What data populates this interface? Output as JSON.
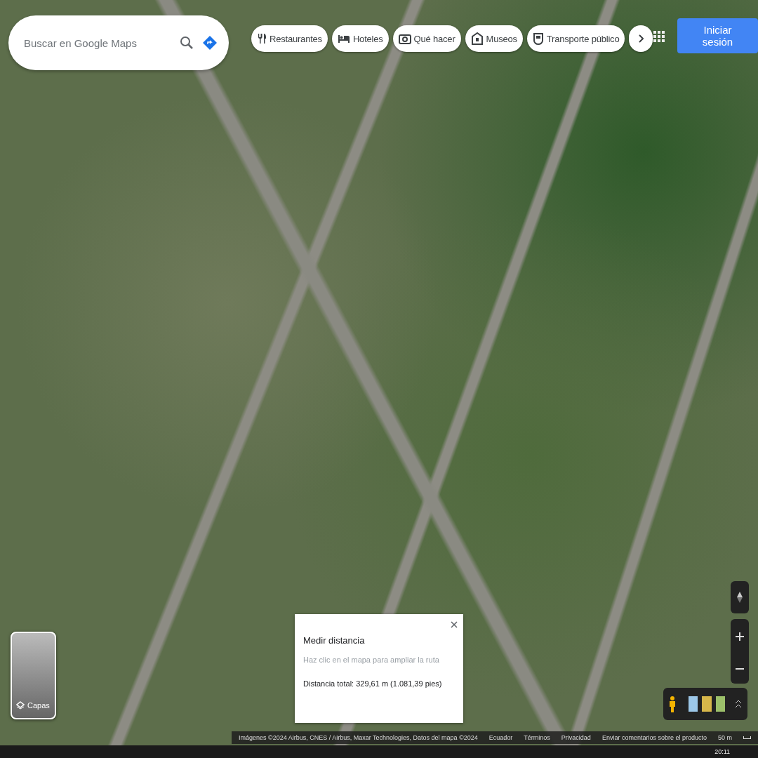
{
  "search": {
    "placeholder": "Buscar en Google Maps"
  },
  "chips": [
    {
      "label": "Restaurantes",
      "kind": "restaurant"
    },
    {
      "label": "Hoteles",
      "kind": "hotel"
    },
    {
      "label": "Qué hacer",
      "kind": "camera"
    },
    {
      "label": "Museos",
      "kind": "museum"
    },
    {
      "label": "Transporte público",
      "kind": "transit"
    }
  ],
  "sign_in": "Iniciar sesión",
  "layers": {
    "label": "Capas"
  },
  "measure": {
    "title": "Medir distancia",
    "hint": "Haz clic en el mapa para ampliar la ruta",
    "total": "Distancia total: 329,61 m (1.081,39 pies)"
  },
  "footer": {
    "attribution": "Imágenes ©2024 Airbus, CNES / Airbus, Maxar Technologies, Datos del mapa ©2024",
    "links": [
      "Ecuador",
      "Términos",
      "Privacidad",
      "Enviar comentarios sobre el producto"
    ],
    "scale": "50 m"
  },
  "taskbar": {
    "time": "20:11"
  }
}
